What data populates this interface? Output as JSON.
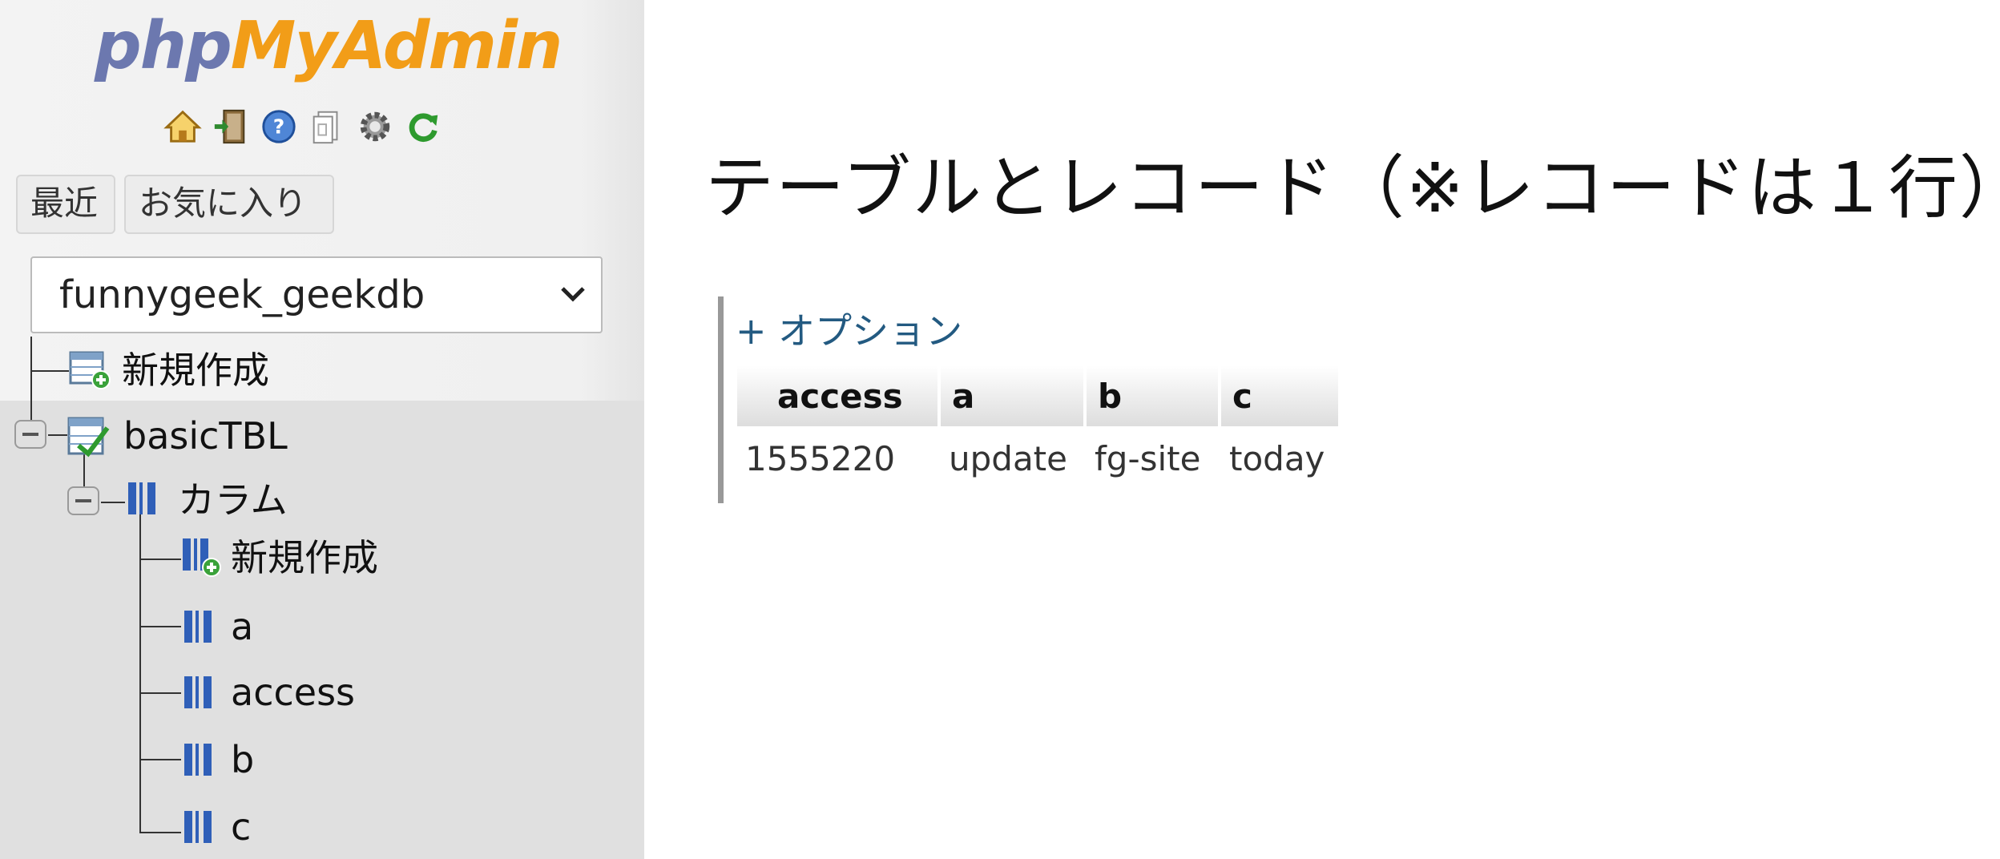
{
  "logo": {
    "part1": "php",
    "part2": "MyAdmin"
  },
  "toolbar": {
    "icons": [
      "home-icon",
      "logout-icon",
      "help-icon",
      "docs-icon",
      "settings-icon",
      "reload-icon"
    ]
  },
  "tabs": {
    "recent": "最近",
    "favorites": "お気に入り"
  },
  "database_select": {
    "value": "funnygeek_geekdb"
  },
  "tree": {
    "new_table": "新規作成",
    "table_name": "basicTBL",
    "columns_group": "カラム",
    "new_column": "新規作成",
    "columns": [
      "a",
      "access",
      "b",
      "c"
    ]
  },
  "heading": "テーブルとレコード（※レコードは１行）",
  "options_link": "+ オプション",
  "table": {
    "headers": [
      "access",
      "a",
      "b",
      "c"
    ],
    "rows": [
      [
        "1555220",
        "update",
        "fg-site",
        "today"
      ]
    ]
  },
  "colors": {
    "logo_php": "#6c78af",
    "logo_myadmin": "#f29d18",
    "link": "#235a81"
  }
}
